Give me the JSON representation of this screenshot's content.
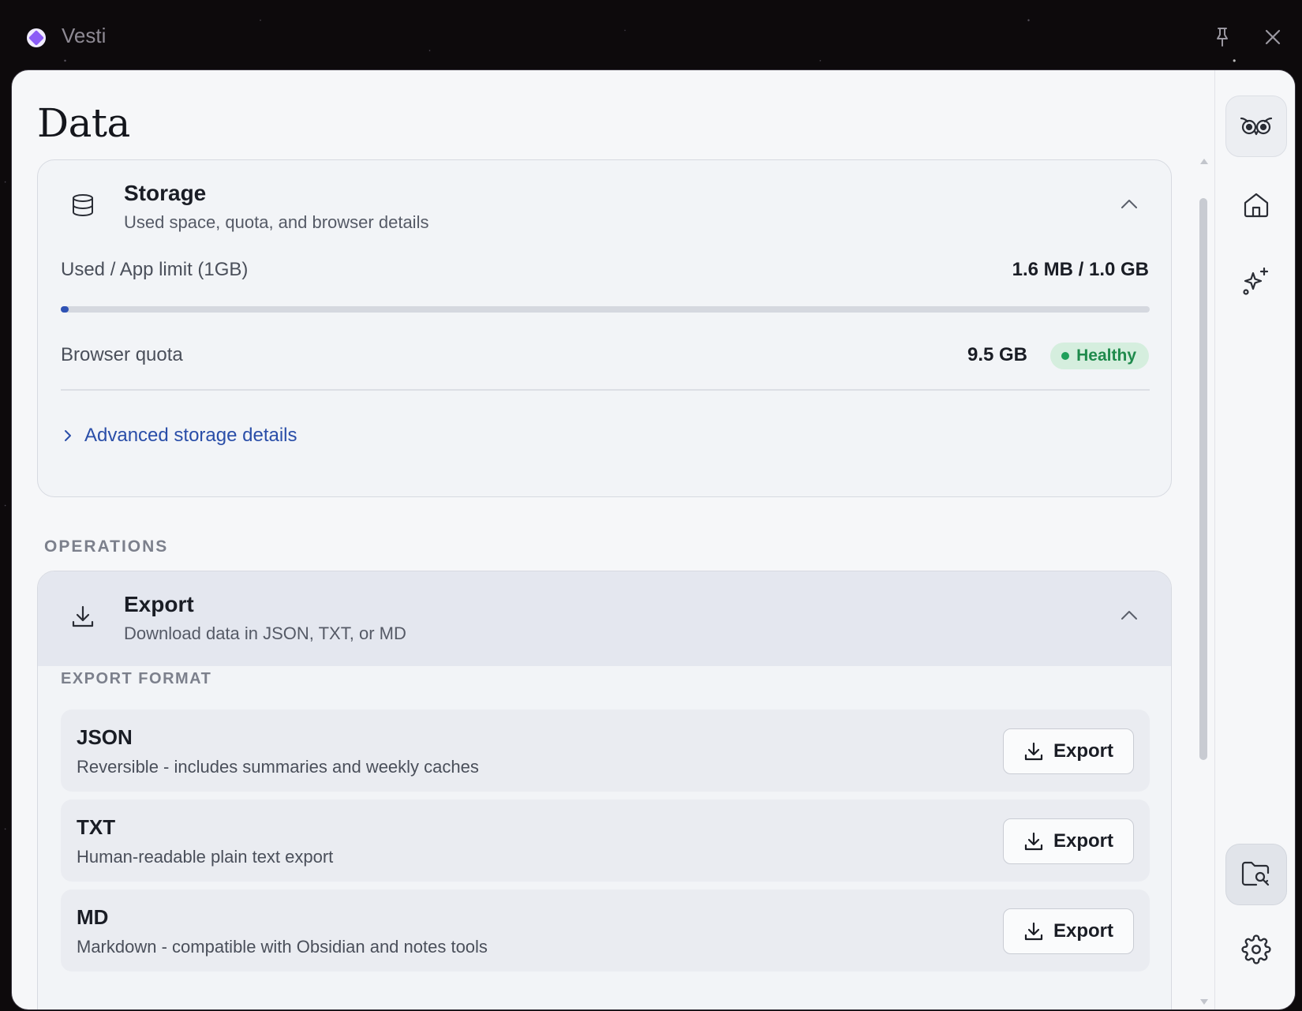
{
  "titlebar": {
    "app_name": "Vesti",
    "icons": [
      "app-logo-icon",
      "pin-icon",
      "close-icon"
    ]
  },
  "page": {
    "title": "Data"
  },
  "storage": {
    "title": "Storage",
    "subtitle": "Used space, quota, and browser details",
    "used_label": "Used / App limit (1GB)",
    "used_value": "1.6 MB / 1.0 GB",
    "used_fraction": 0.0016,
    "quota_label": "Browser quota",
    "quota_value": "9.5 GB",
    "quota_status": "Healthy",
    "advanced_link": "Advanced storage details"
  },
  "operations": {
    "section_label": "OPERATIONS"
  },
  "export": {
    "title": "Export",
    "subtitle": "Download data in JSON, TXT, or MD",
    "format_label": "EXPORT FORMAT",
    "formats": [
      {
        "name": "JSON",
        "description": "Reversible - includes summaries and weekly caches",
        "button": "Export"
      },
      {
        "name": "TXT",
        "description": "Human-readable plain text export",
        "button": "Export"
      },
      {
        "name": "MD",
        "description": "Markdown - compatible with Obsidian and notes tools",
        "button": "Export"
      }
    ]
  },
  "rail": {
    "items": [
      "owl-icon",
      "home-icon",
      "sparkle-icon",
      "data-folder-icon",
      "settings-icon"
    ],
    "active": "data-folder-icon"
  },
  "colors": {
    "accent": "#2f52b5",
    "link": "#2a4ea8",
    "healthy_bg": "#d5eede",
    "healthy_text": "#1f8a4c",
    "logo": "#8b5cf6"
  }
}
